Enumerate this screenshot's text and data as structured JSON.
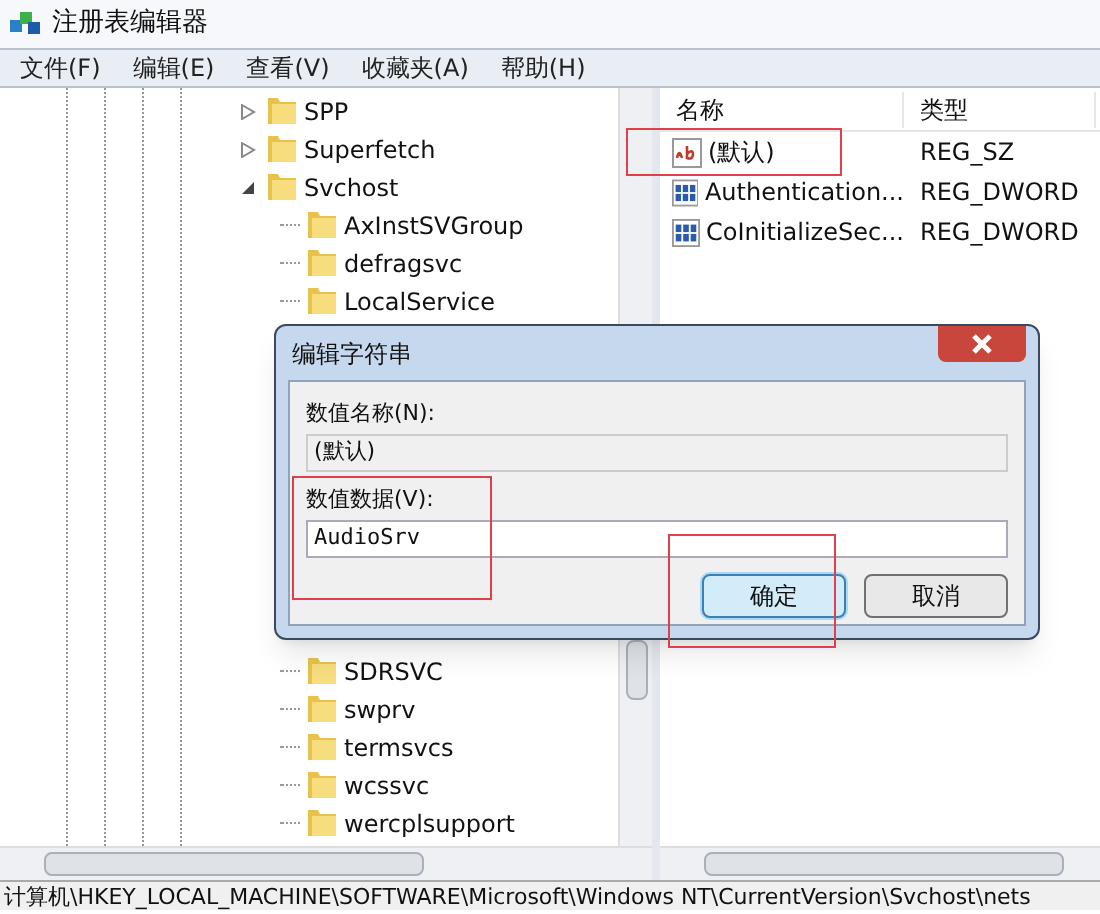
{
  "window": {
    "title": "注册表编辑器"
  },
  "menu": [
    "文件(F)",
    "编辑(E)",
    "查看(V)",
    "收藏夹(A)",
    "帮助(H)"
  ],
  "tree": [
    {
      "label": "SPP",
      "expanded": false
    },
    {
      "label": "Superfetch",
      "expanded": false
    },
    {
      "label": "Svchost",
      "expanded": true,
      "children": [
        {
          "label": "AxInstSVGroup"
        },
        {
          "label": "defragsvc"
        },
        {
          "label": "LocalService"
        },
        {
          "label": "SDRSVC"
        },
        {
          "label": "swprv"
        },
        {
          "label": "termsvcs"
        },
        {
          "label": "wcssvc"
        },
        {
          "label": "wercplsupport"
        }
      ]
    }
  ],
  "values": {
    "columns": [
      "名称",
      "类型"
    ],
    "rows": [
      {
        "name": "(默认)",
        "type": "REG_SZ",
        "kind": "string"
      },
      {
        "name": "Authentication...",
        "type": "REG_DWORD",
        "kind": "dword"
      },
      {
        "name": "CoInitializeSec...",
        "type": "REG_DWORD",
        "kind": "dword"
      }
    ]
  },
  "dialog": {
    "title": "编辑字符串",
    "name_label": "数值名称(N):",
    "name_value": "(默认)",
    "data_label": "数值数据(V):",
    "data_value": "AudioSrv",
    "buttons": [
      {
        "label": "确定",
        "default": true
      },
      {
        "label": "取消",
        "default": false
      }
    ]
  },
  "status_bar": "计算机\\HKEY_LOCAL_MACHINE\\SOFTWARE\\Microsoft\\Windows NT\\CurrentVersion\\Svchost\\nets"
}
